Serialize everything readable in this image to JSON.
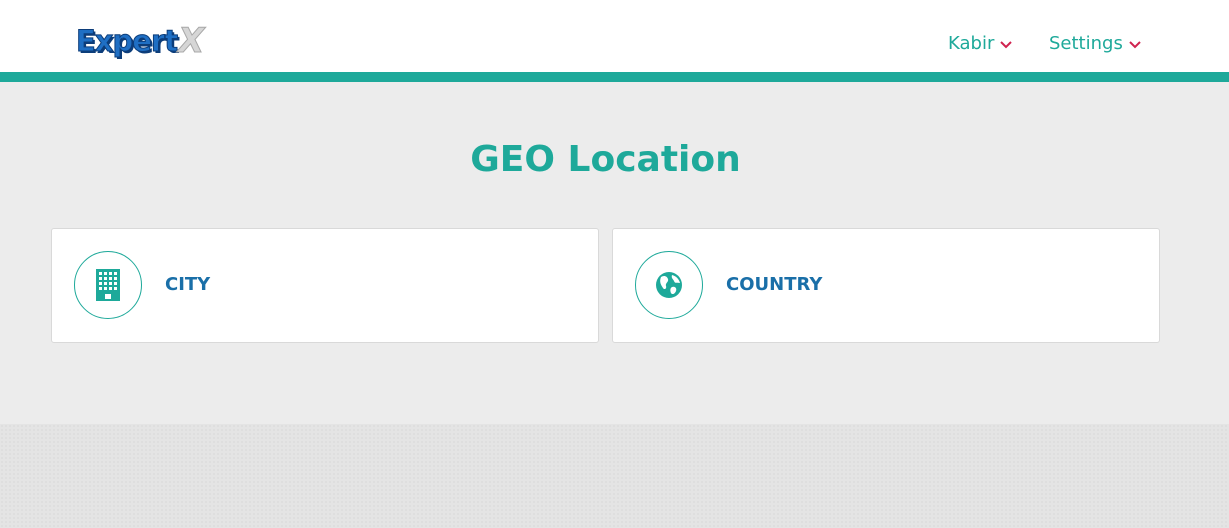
{
  "brand": {
    "logo_main": "Expert",
    "logo_accent": "X"
  },
  "header": {
    "user_menu": {
      "label": "Kabir",
      "icon": "chevron-down-icon"
    },
    "settings_menu": {
      "label": "Settings",
      "icon": "chevron-down-icon"
    }
  },
  "main": {
    "title": "GEO Location",
    "cards": [
      {
        "label": "CITY",
        "icon": "building-icon"
      },
      {
        "label": "COUNTRY",
        "icon": "globe-icon"
      }
    ]
  },
  "colors": {
    "accent": "#1ea99a",
    "label_blue": "#1a6fa8",
    "chevron": "#d0234f",
    "background": "#ececec"
  }
}
